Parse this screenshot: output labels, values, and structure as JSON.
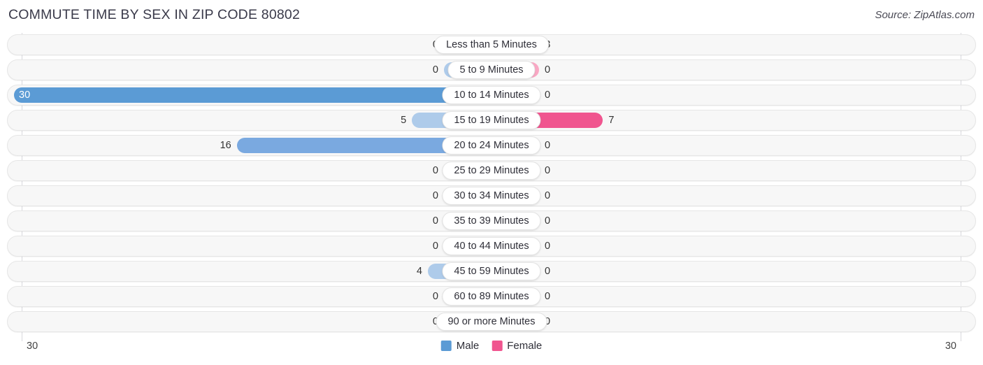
{
  "header": {
    "title": "COMMUTE TIME BY SEX IN ZIP CODE 80802",
    "source": "Source: ZipAtlas.com"
  },
  "legend": {
    "male_label": "Male",
    "female_label": "Female"
  },
  "axis": {
    "left_end_label": "30",
    "right_end_label": "30"
  },
  "colors": {
    "male_strong": "#5b9bd5",
    "male_mid": "#7aa9e0",
    "male_pale": "#aecbea",
    "female_strong": "#f0558f",
    "female_mid": "#f578a4",
    "female_pale": "#f9a8c4",
    "track": "#f7f7f7",
    "gridline": "#d8d8dd",
    "title": "#3a3a4a"
  },
  "chart_data": {
    "type": "bar",
    "subtype": "diverging-bidirectional",
    "title": "COMMUTE TIME BY SEX IN ZIP CODE 80802",
    "xlabel": "",
    "ylabel": "",
    "xlim": [
      30,
      30
    ],
    "axis_max": 30,
    "grid": true,
    "legend_position": "bottom-center",
    "categories": [
      "Less than 5 Minutes",
      "5 to 9 Minutes",
      "10 to 14 Minutes",
      "15 to 19 Minutes",
      "20 to 24 Minutes",
      "25 to 29 Minutes",
      "30 to 34 Minutes",
      "35 to 39 Minutes",
      "40 to 44 Minutes",
      "45 to 59 Minutes",
      "60 to 89 Minutes",
      "90 or more Minutes"
    ],
    "series": [
      {
        "name": "Male",
        "direction": "left",
        "values": [
          0,
          0,
          30,
          5,
          16,
          0,
          0,
          0,
          0,
          4,
          0,
          0
        ]
      },
      {
        "name": "Female",
        "direction": "right",
        "values": [
          3,
          0,
          0,
          7,
          0,
          0,
          0,
          0,
          0,
          0,
          0,
          0
        ]
      }
    ],
    "rows": [
      {
        "category": "Less than 5 Minutes",
        "male": "0",
        "female": "3"
      },
      {
        "category": "5 to 9 Minutes",
        "male": "0",
        "female": "0"
      },
      {
        "category": "10 to 14 Minutes",
        "male": "30",
        "female": "0"
      },
      {
        "category": "15 to 19 Minutes",
        "male": "5",
        "female": "7"
      },
      {
        "category": "20 to 24 Minutes",
        "male": "16",
        "female": "0"
      },
      {
        "category": "25 to 29 Minutes",
        "male": "0",
        "female": "0"
      },
      {
        "category": "30 to 34 Minutes",
        "male": "0",
        "female": "0"
      },
      {
        "category": "35 to 39 Minutes",
        "male": "0",
        "female": "0"
      },
      {
        "category": "40 to 44 Minutes",
        "male": "0",
        "female": "0"
      },
      {
        "category": "45 to 59 Minutes",
        "male": "4",
        "female": "0"
      },
      {
        "category": "60 to 89 Minutes",
        "male": "0",
        "female": "0"
      },
      {
        "category": "90 or more Minutes",
        "male": "0",
        "female": "0"
      }
    ]
  }
}
